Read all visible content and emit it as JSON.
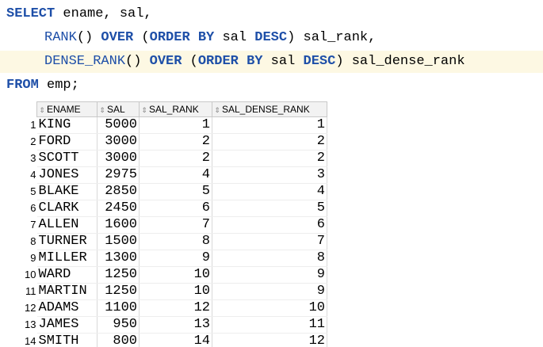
{
  "editor": {
    "line1": {
      "kw": "SELECT",
      "rest": " ename, sal,"
    },
    "line2": {
      "fn": "RANK",
      "p1": "() ",
      "over": "OVER",
      "p2": " (",
      "order": "ORDER BY",
      "p3": " sal ",
      "desc": "DESC",
      "p4": ") sal_rank,"
    },
    "line3": {
      "fn": "DENSE_RANK",
      "p1": "() ",
      "over": "OVER",
      "p2": " (",
      "order": "ORDER BY",
      "p3": " sal ",
      "desc": "DESC",
      "p4": ") sal_dense_rank"
    },
    "line4": {
      "kw": "FROM",
      "rest": " emp;"
    }
  },
  "grid": {
    "columns": [
      "ENAME",
      "SAL",
      "SAL_RANK",
      "SAL_DENSE_RANK"
    ],
    "rows": [
      {
        "n": "1",
        "ename": "KING",
        "sal": "5000",
        "rank": "1",
        "drank": "1"
      },
      {
        "n": "2",
        "ename": "FORD",
        "sal": "3000",
        "rank": "2",
        "drank": "2"
      },
      {
        "n": "3",
        "ename": "SCOTT",
        "sal": "3000",
        "rank": "2",
        "drank": "2"
      },
      {
        "n": "4",
        "ename": "JONES",
        "sal": "2975",
        "rank": "4",
        "drank": "3"
      },
      {
        "n": "5",
        "ename": "BLAKE",
        "sal": "2850",
        "rank": "5",
        "drank": "4"
      },
      {
        "n": "6",
        "ename": "CLARK",
        "sal": "2450",
        "rank": "6",
        "drank": "5"
      },
      {
        "n": "7",
        "ename": "ALLEN",
        "sal": "1600",
        "rank": "7",
        "drank": "6"
      },
      {
        "n": "8",
        "ename": "TURNER",
        "sal": "1500",
        "rank": "8",
        "drank": "7"
      },
      {
        "n": "9",
        "ename": "MILLER",
        "sal": "1300",
        "rank": "9",
        "drank": "8"
      },
      {
        "n": "10",
        "ename": "WARD",
        "sal": "1250",
        "rank": "10",
        "drank": "9"
      },
      {
        "n": "11",
        "ename": "MARTIN",
        "sal": "1250",
        "rank": "10",
        "drank": "9"
      },
      {
        "n": "12",
        "ename": "ADAMS",
        "sal": "1100",
        "rank": "12",
        "drank": "10"
      },
      {
        "n": "13",
        "ename": "JAMES",
        "sal": "950",
        "rank": "13",
        "drank": "11"
      },
      {
        "n": "14",
        "ename": "SMITH",
        "sal": "800",
        "rank": "14",
        "drank": "12"
      }
    ]
  },
  "icons": {
    "sort": "sort-arrows-icon"
  },
  "colors": {
    "keyword": "#1e4fa8",
    "current_line": "#fdf8e3",
    "header_bg": "#f2f2f2"
  }
}
